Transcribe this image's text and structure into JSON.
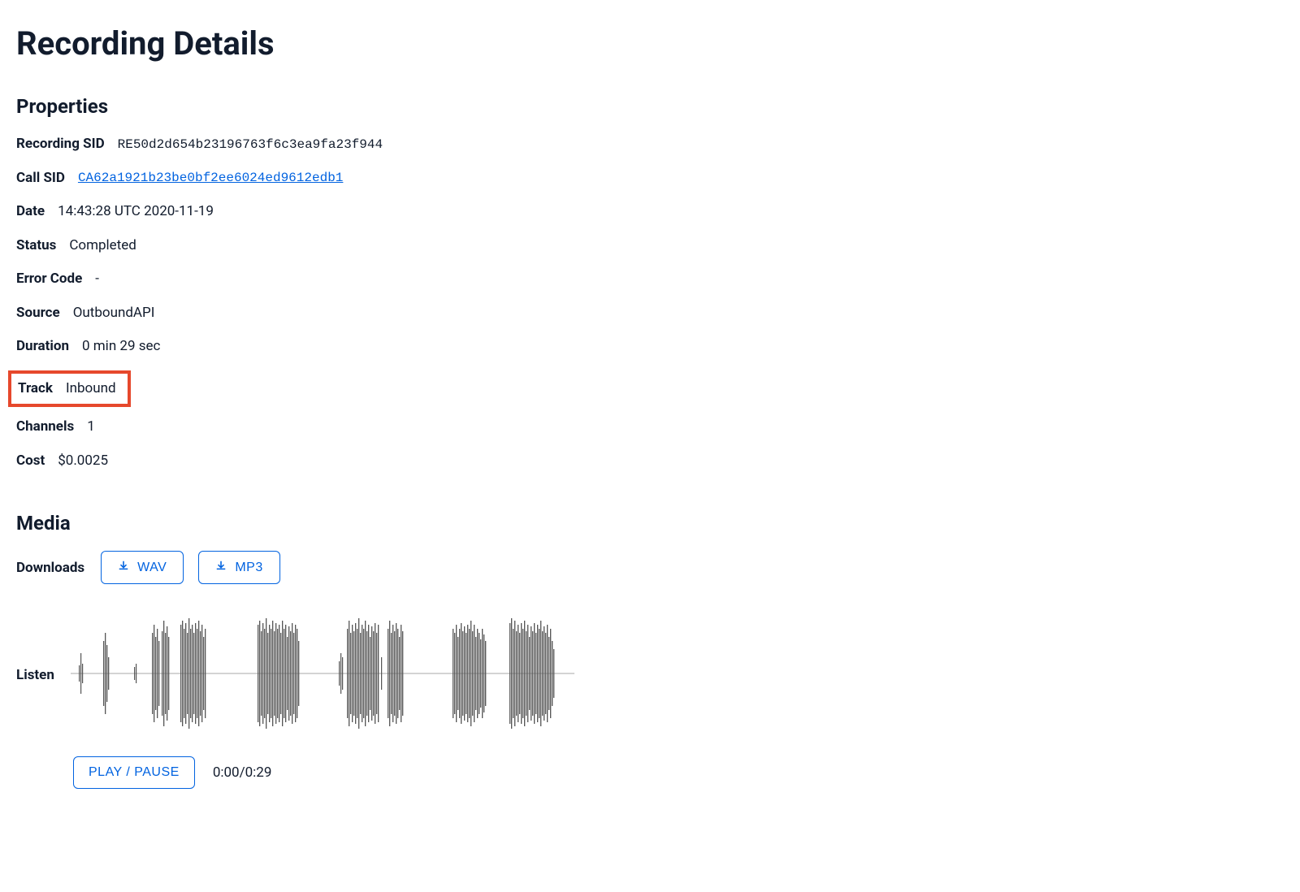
{
  "page_title": "Recording Details",
  "sections": {
    "properties_title": "Properties",
    "media_title": "Media"
  },
  "properties": {
    "recording_sid": {
      "label": "Recording SID",
      "value": "RE50d2d654b23196763f6c3ea9fa23f944"
    },
    "call_sid": {
      "label": "Call SID",
      "value": "CA62a1921b23be0bf2ee6024ed9612edb1"
    },
    "date": {
      "label": "Date",
      "value": "14:43:28 UTC 2020-11-19"
    },
    "status": {
      "label": "Status",
      "value": "Completed"
    },
    "error_code": {
      "label": "Error Code",
      "value": "-"
    },
    "source": {
      "label": "Source",
      "value": "OutboundAPI"
    },
    "duration": {
      "label": "Duration",
      "value": "0 min 29 sec"
    },
    "track": {
      "label": "Track",
      "value": "Inbound"
    },
    "channels": {
      "label": "Channels",
      "value": "1"
    },
    "cost": {
      "label": "Cost",
      "value": "$0.0025"
    }
  },
  "media": {
    "downloads_label": "Downloads",
    "wav_label": "WAV",
    "mp3_label": "MP3",
    "listen_label": "Listen",
    "play_pause_label": "PLAY / PAUSE",
    "time_display": "0:00/0:29"
  }
}
